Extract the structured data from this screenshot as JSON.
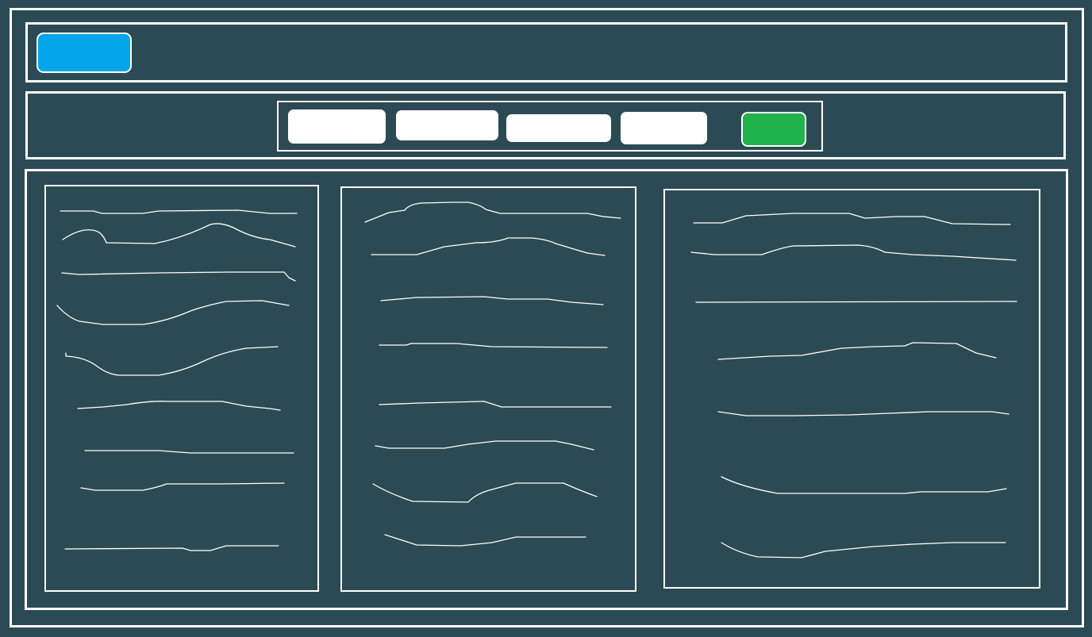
{
  "theme": {
    "background": "#2c4a54",
    "border": "#ffffff",
    "logo_color": "#00a5ea",
    "action_color": "#22b24c"
  },
  "header": {
    "logo_label": ""
  },
  "toolbar": {
    "tabs": [
      {
        "label": ""
      },
      {
        "label": ""
      },
      {
        "label": ""
      },
      {
        "label": ""
      }
    ],
    "action_label": ""
  },
  "columns": [
    {
      "lines": 9
    },
    {
      "lines": 8
    },
    {
      "lines": 7
    }
  ]
}
